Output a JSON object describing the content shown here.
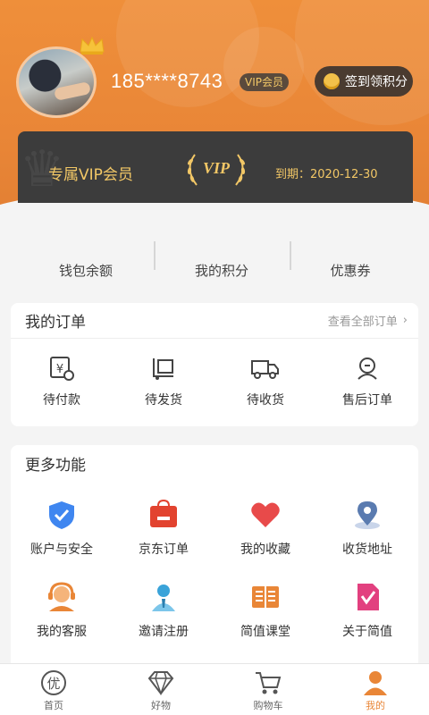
{
  "user": {
    "phone": "185****8743",
    "vip_tag": "VIP会员",
    "signin_label": "签到领积分"
  },
  "vip_card": {
    "title": "专属VIP会员",
    "badge_text": "VIP",
    "expire_label": "到期：",
    "expire_date": "2020-12-30"
  },
  "stats": [
    {
      "label": "钱包余额"
    },
    {
      "label": "我的积分"
    },
    {
      "label": "优惠券"
    }
  ],
  "orders": {
    "title": "我的订单",
    "view_all": "查看全部订单",
    "items": [
      {
        "label": "待付款",
        "icon": "payment-icon"
      },
      {
        "label": "待发货",
        "icon": "pending-shipment-icon"
      },
      {
        "label": "待收货",
        "icon": "delivery-truck-icon"
      },
      {
        "label": "售后订单",
        "icon": "after-sales-icon"
      }
    ]
  },
  "more": {
    "title": "更多功能",
    "items": [
      {
        "label": "账户与安全",
        "icon": "shield-check-icon",
        "color": "#3f86f0"
      },
      {
        "label": "京东订单",
        "icon": "shopping-bag-icon",
        "color": "#e2432f"
      },
      {
        "label": "我的收藏",
        "icon": "heart-icon",
        "color": "#e84a4a"
      },
      {
        "label": "收货地址",
        "icon": "location-pin-icon",
        "color": "#5a7bb0"
      },
      {
        "label": "我的客服",
        "icon": "customer-service-icon",
        "color": "#e98637"
      },
      {
        "label": "邀请注册",
        "icon": "invite-user-icon",
        "color": "#3aa3d9"
      },
      {
        "label": "简值课堂",
        "icon": "book-icon",
        "color": "#e98637"
      },
      {
        "label": "关于简值",
        "icon": "about-icon",
        "color": "#e2407f"
      }
    ]
  },
  "tabs": [
    {
      "label": "首页",
      "icon": "home-icon",
      "active": false
    },
    {
      "label": "好物",
      "icon": "diamond-icon",
      "active": false
    },
    {
      "label": "购物车",
      "icon": "cart-icon",
      "active": false
    },
    {
      "label": "我的",
      "icon": "profile-icon",
      "active": true
    }
  ],
  "colors": {
    "brand_orange": "#e98637",
    "vip_gold": "#f2c766",
    "card_dark": "#3c3c3c"
  }
}
